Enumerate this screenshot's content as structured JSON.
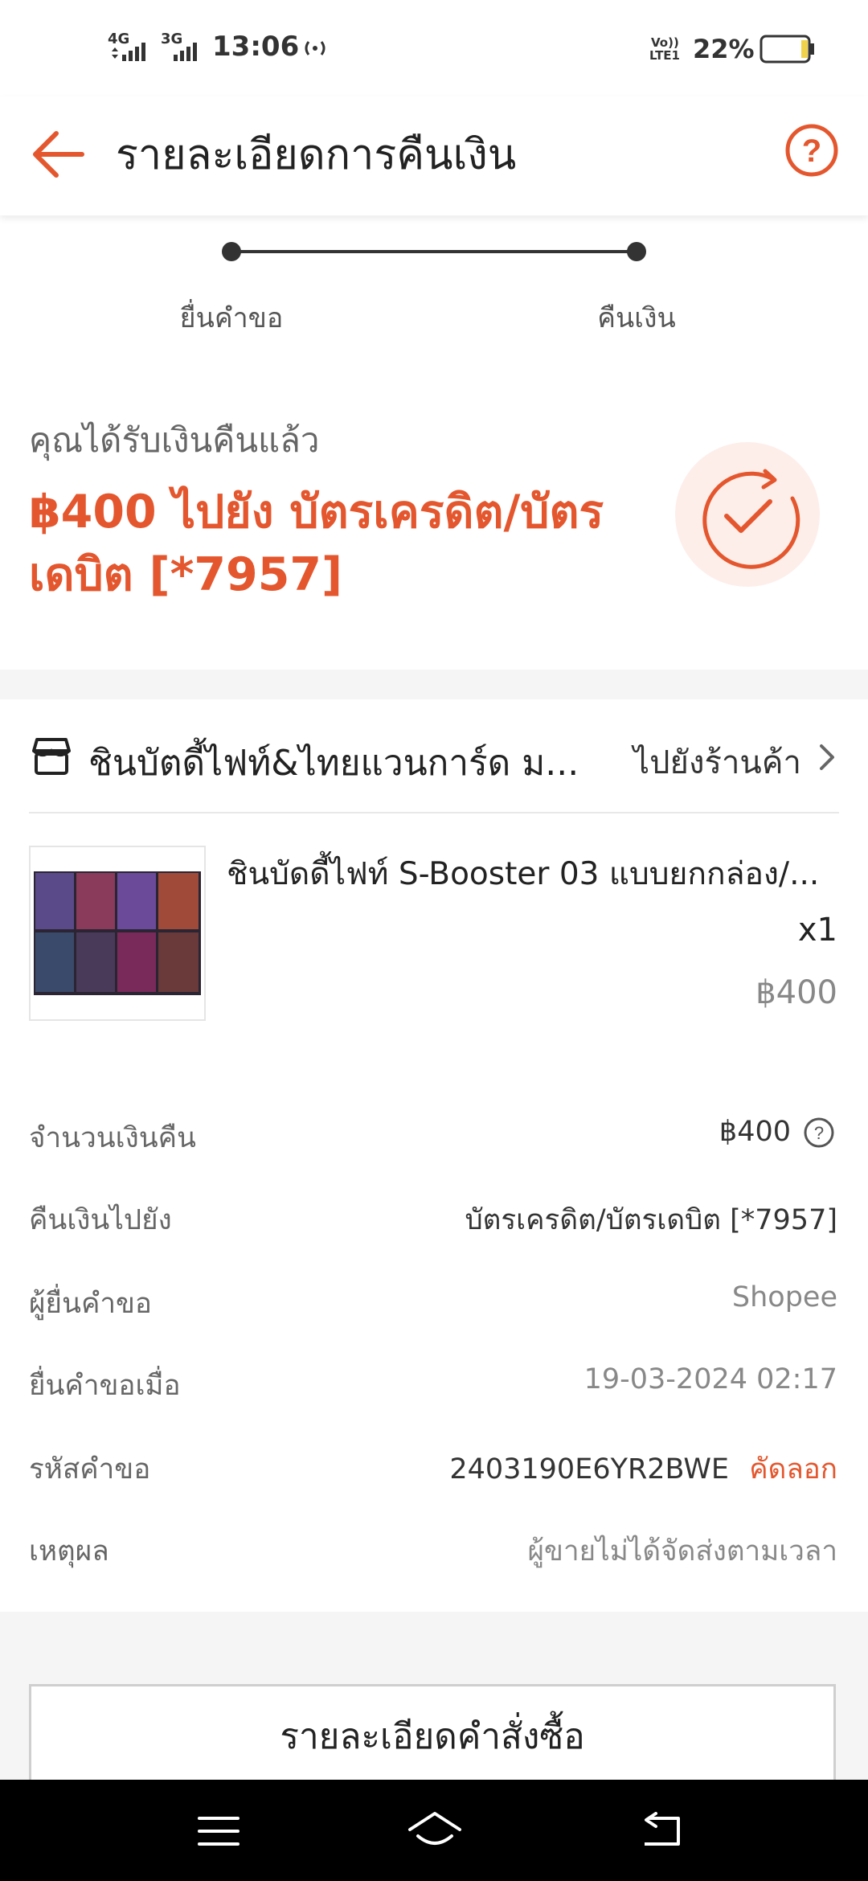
{
  "status_bar": {
    "net1": "4G",
    "net2": "3G",
    "time": "13:06",
    "volte": "Vo))",
    "lte": "LTE1",
    "battery": "22%"
  },
  "header": {
    "title": "รายละเอียดการคืนเงิน"
  },
  "progress": {
    "steps": [
      "ยื่นคำขอ",
      "คืนเงิน"
    ]
  },
  "refund": {
    "subtitle": "คุณได้รับเงินคืนแล้ว",
    "line1": "฿400 ไปยัง บัตรเครดิต/บัตร",
    "line2": "เดบิต [*7957]"
  },
  "shop": {
    "name": "ชินบัตดี้ไฟท์&ไทยแวนการ์ด ม...",
    "goto_label": "ไปยังร้านค้า"
  },
  "product": {
    "name": "ชินบัดดี้ไฟท์ S-Booster 03 แบบยกกล่อง/...",
    "qty": "x1",
    "price": "฿400"
  },
  "details": [
    {
      "label": "จำนวนเงินคืน",
      "value": "฿400"
    },
    {
      "label": "คืนเงินไปยัง",
      "value": "บัตรเครดิต/บัตรเดบิต [*7957]"
    },
    {
      "label": "ผู้ยื่นคำขอ",
      "value": "Shopee"
    },
    {
      "label": "ยื่นคำขอเมื่อ",
      "value": "19-03-2024 02:17"
    },
    {
      "label": "รหัสคำขอ",
      "value": "2403190E6YR2BWE",
      "action": "คัดลอก"
    },
    {
      "label": "เหตุผล",
      "value": "ผู้ขายไม่ได้จัดส่งตามเวลา"
    }
  ],
  "order_button": "รายละเอียดคำสั่งซื้อ",
  "colors": {
    "accent": "#e4572e",
    "background": "#f5f5f5"
  },
  "icons": [
    "back-arrow-icon",
    "help-icon",
    "refund-check-icon",
    "shop-icon",
    "chevron-right-icon",
    "info-icon",
    "menu-icon",
    "home-icon",
    "back-icon"
  ]
}
